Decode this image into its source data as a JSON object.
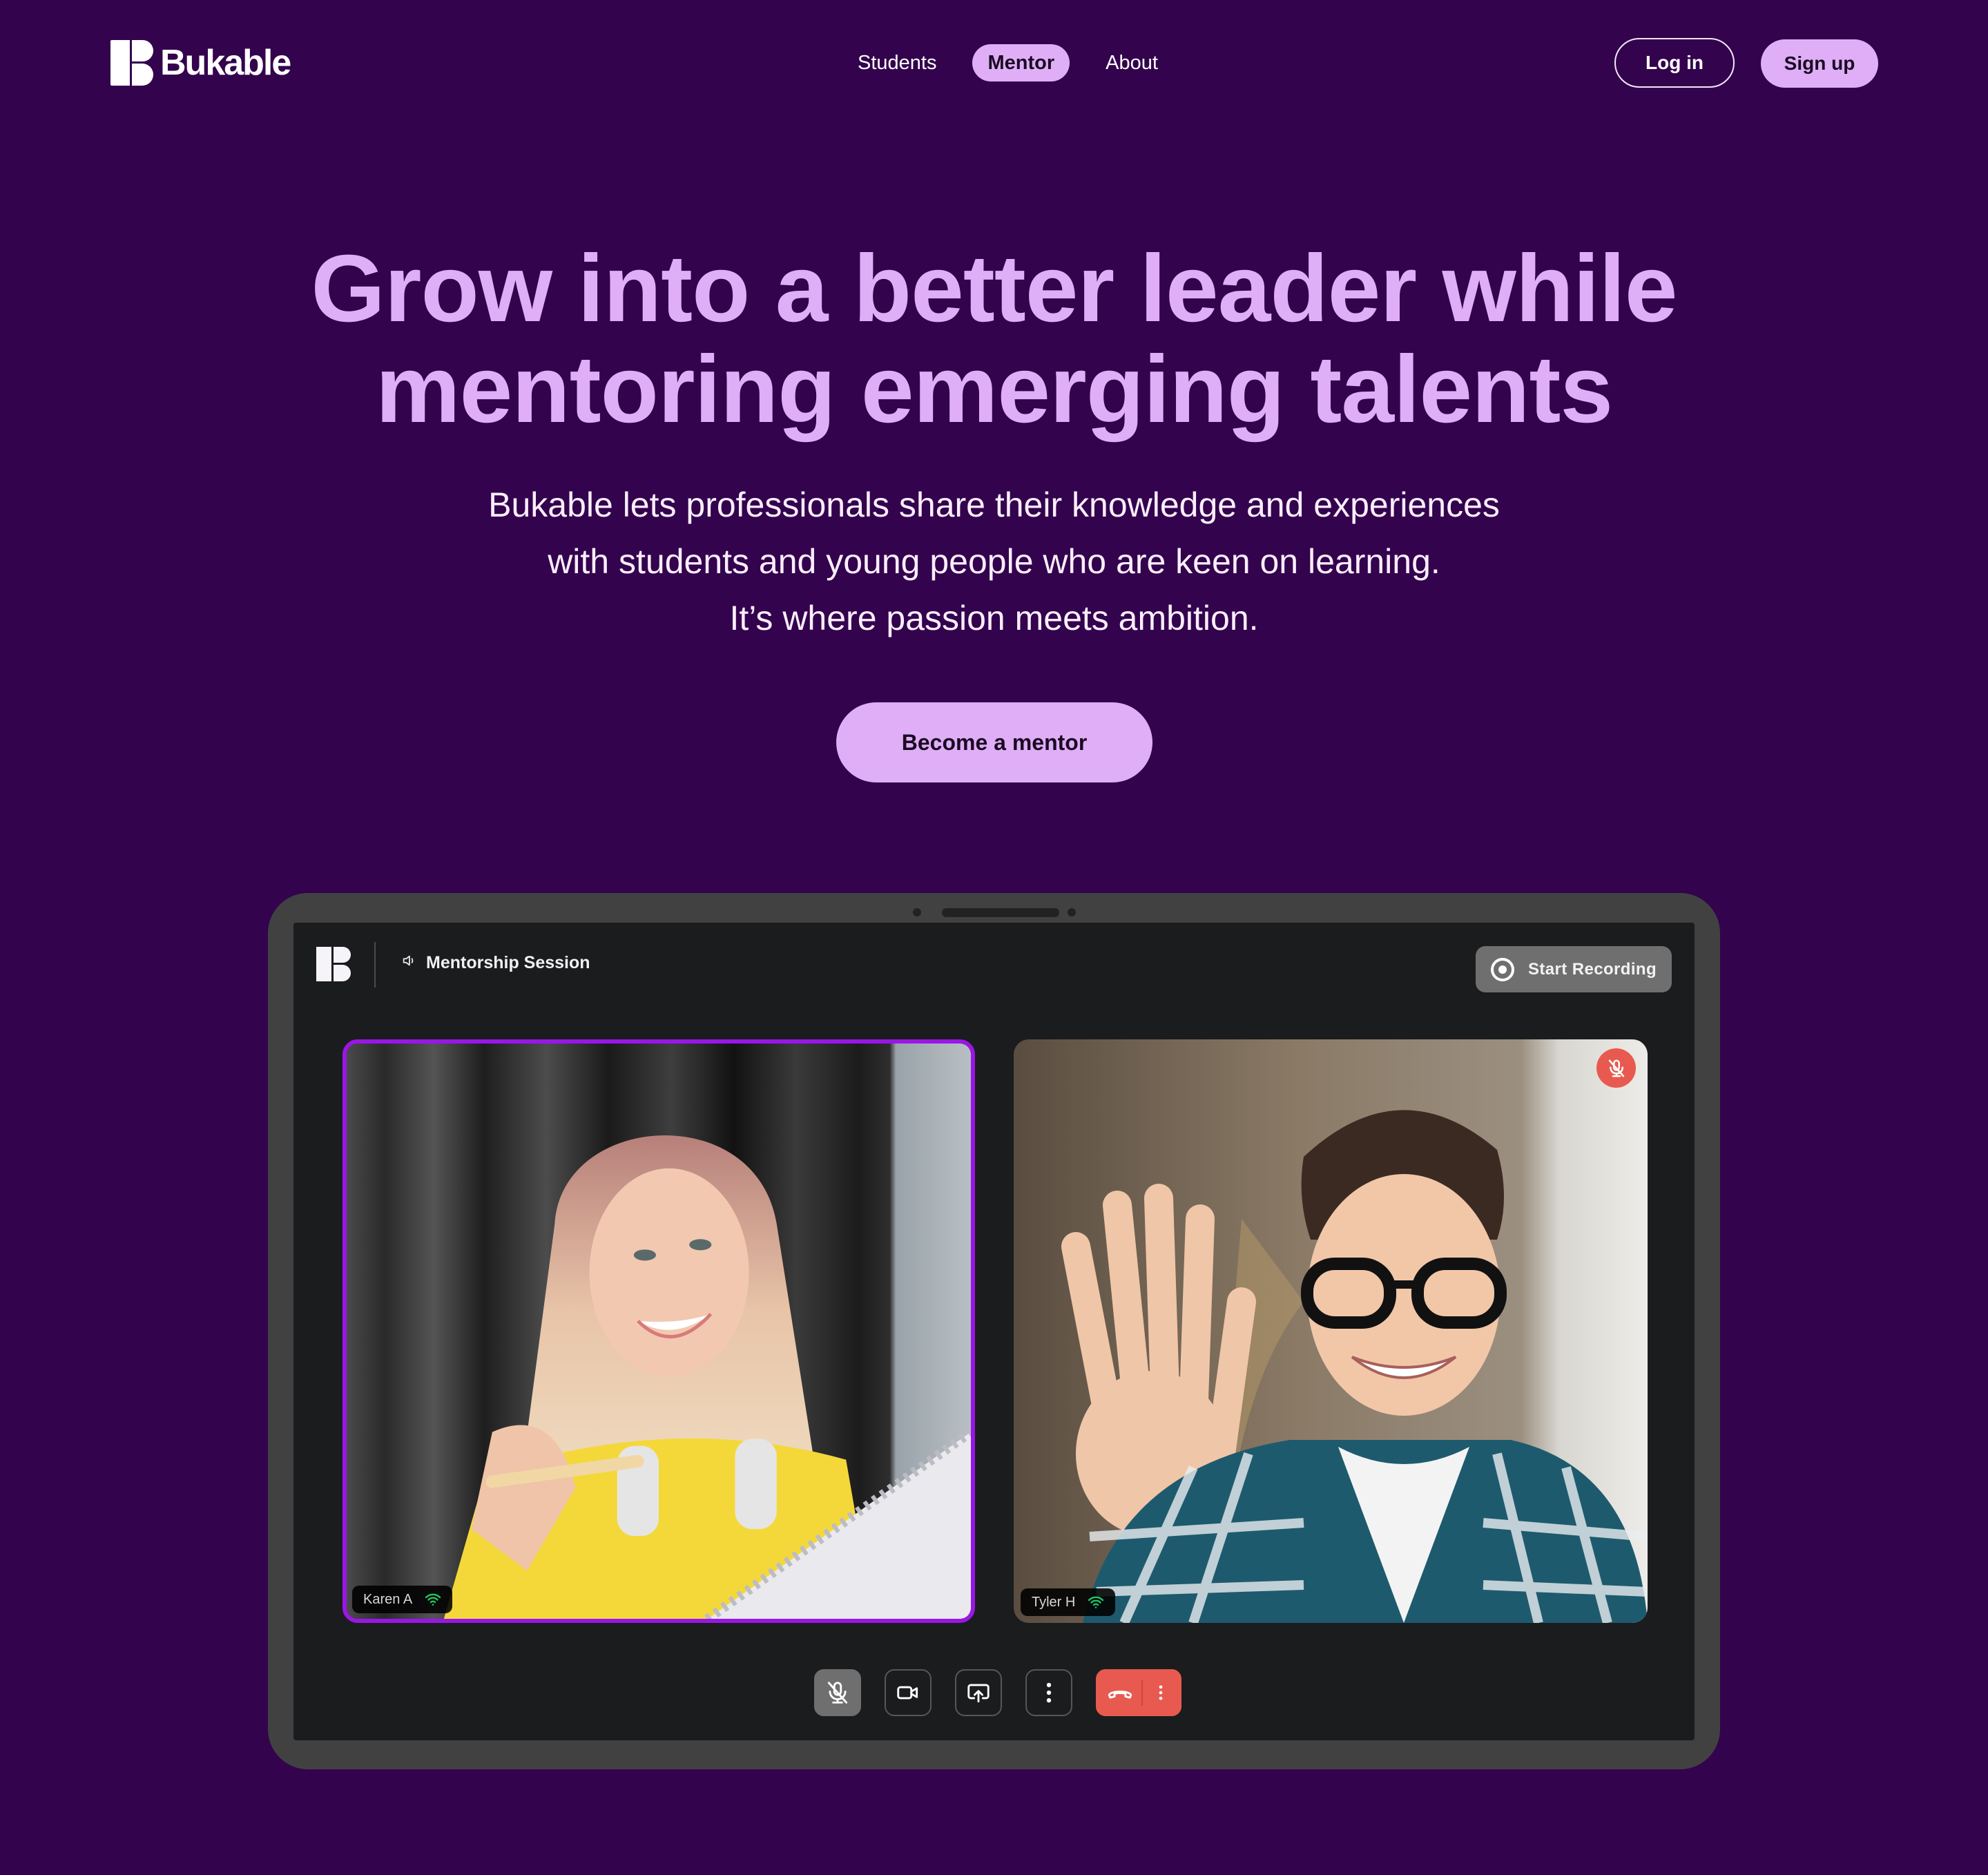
{
  "brand": {
    "name": "Bukable",
    "accent": "#e0aef7",
    "background": "#33034d"
  },
  "nav": {
    "items": [
      {
        "label": "Students",
        "active": false
      },
      {
        "label": "Mentor",
        "active": true
      },
      {
        "label": "About",
        "active": false
      }
    ],
    "login_label": "Log in",
    "signup_label": "Sign up"
  },
  "hero": {
    "headline_lines": [
      "Grow into a better leader while",
      "mentoring emerging talents"
    ],
    "subtitle_lines": [
      "Bukable lets professionals share their knowledge and experiences",
      "with students and young people who are keen on learning.",
      "It’s where passion meets ambition."
    ],
    "cta_label": "Become a mentor"
  },
  "call": {
    "title": "Mentorship Session",
    "title_icon": "speaker-icon",
    "record_label": "Start Recording",
    "participants": [
      {
        "name": "Karen A",
        "active_speaker": true,
        "muted": false,
        "signal": "good"
      },
      {
        "name": "Tyler H",
        "active_speaker": false,
        "muted": true,
        "signal": "good"
      }
    ],
    "controls": [
      {
        "name": "mute-toggle",
        "icon": "mic-off-icon",
        "state": "muted"
      },
      {
        "name": "camera-toggle",
        "icon": "video-camera-icon"
      },
      {
        "name": "share-screen",
        "icon": "screen-share-icon"
      },
      {
        "name": "more-options",
        "icon": "more-vertical-icon"
      },
      {
        "name": "end-call",
        "icon": "hang-up-icon",
        "color": "#e85a4f"
      }
    ]
  }
}
